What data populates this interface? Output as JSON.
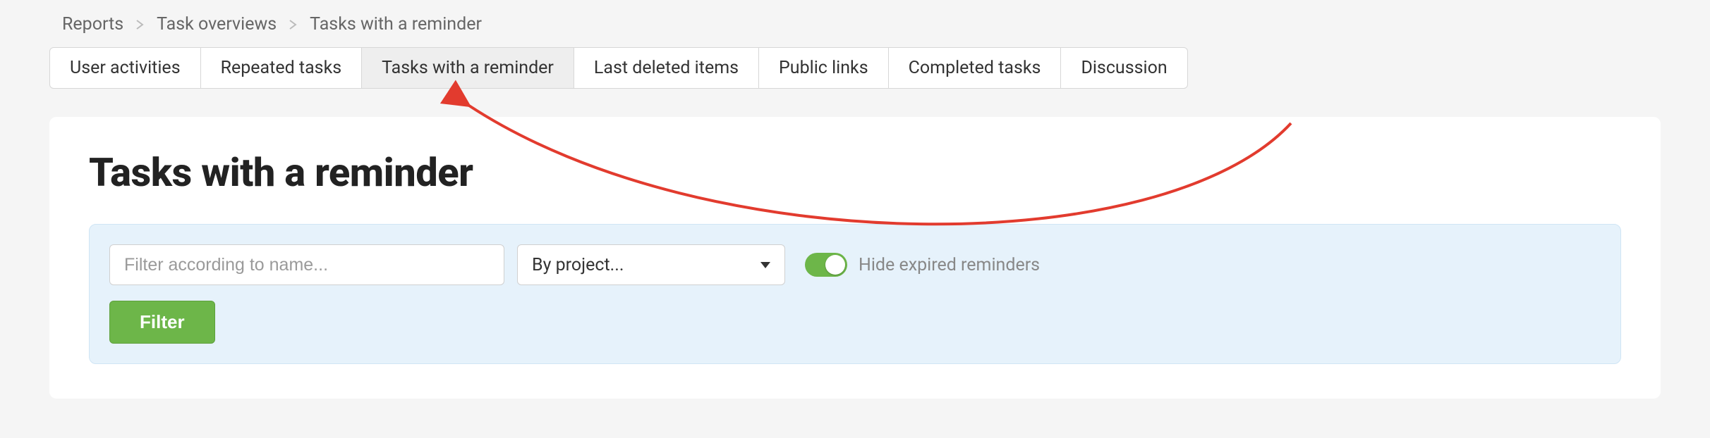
{
  "breadcrumb": {
    "items": [
      "Reports",
      "Task overviews",
      "Tasks with a reminder"
    ]
  },
  "tabs": {
    "items": [
      "User activities",
      "Repeated tasks",
      "Tasks with a reminder",
      "Last deleted items",
      "Public links",
      "Completed tasks",
      "Discussion"
    ],
    "active_index": 2
  },
  "page": {
    "title": "Tasks with a reminder"
  },
  "filters": {
    "name_placeholder": "Filter according to name...",
    "name_value": "",
    "project_select_label": "By project...",
    "toggle_label": "Hide expired reminders",
    "toggle_on": true,
    "button_label": "Filter"
  },
  "colors": {
    "panel_bg": "#e6f2fb",
    "accent_green": "#6db649",
    "annotation_red": "#e23b2e"
  }
}
